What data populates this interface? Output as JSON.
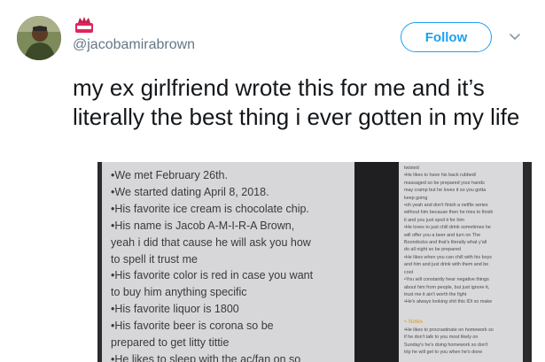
{
  "user": {
    "handle": "@jacobamirabrown",
    "avatar_icon": "profile-photo",
    "badge_icon": "emoji-badge"
  },
  "follow": {
    "label": "Follow",
    "accent_color": "#1da1f2"
  },
  "menu": {
    "icon": "chevron-down-icon"
  },
  "tweet": {
    "text": "my ex girlfriend wrote this for me and it’s literally the best thing i ever gotten in my life"
  },
  "media": {
    "main_note_lines": [
      "•We met February 26th.",
      "•We started dating April 8, 2018.",
      "•His favorite ice cream is chocolate chip.",
      "•His name is Jacob A-M-I-R-A Brown,",
      "yeah i did that cause he will ask you how",
      "to spell it trust me",
      "•His favorite color is red in case you want",
      "to buy him anything specific",
      "•His favorite liquor is 1800",
      "•His favorite beer is corona so be",
      "prepared to get litty tittie",
      "•He likes to sleep with the ac/fan on so"
    ],
    "side_note_lines": [
      "twisted",
      "•He likes to have his back rubbed/",
      "massaged so be prepared your hands",
      "may cramp but he loves it so you gotta",
      "keep going",
      "•oh yeah and don't finish a netflix series",
      "without him because then he tries to finish",
      "it and you just spoil it for him",
      "•He loves to just chill drink sometimes he",
      "will offer you a beer and turn on The",
      "Boondocks and that's literally what y'all",
      "do all night so be prepared",
      "•He likes when you can chill with his boys",
      "and him and just drink with them and be",
      "cool",
      "•You will constantly hear negative things",
      "about him from people, but just ignore it,",
      "trust me it ain't worth the fight",
      "•He's always looking shit this IDI so make"
    ],
    "side_back_label": "< Notes",
    "side_note_lower_lines": [
      "•He likes to procrastinate on homework so",
      "if he don't talk to you most likely on",
      "Sunday's he's doing homework so don't",
      "trip he will get to you when he's done"
    ]
  }
}
